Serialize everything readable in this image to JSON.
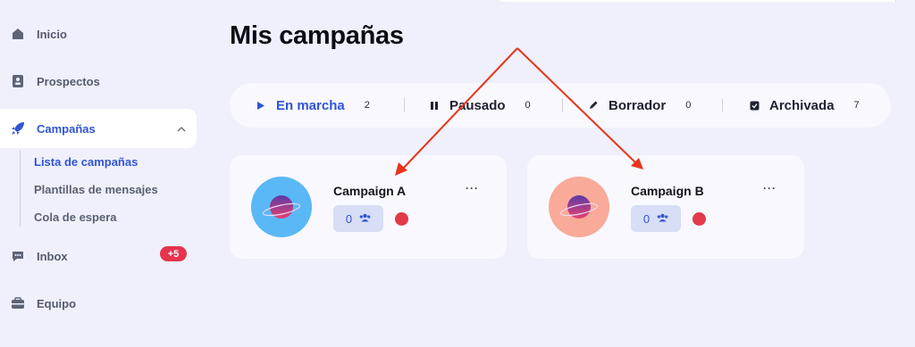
{
  "sidebar": {
    "items": [
      {
        "label": "Inicio",
        "icon": "home-icon"
      },
      {
        "label": "Prospectos",
        "icon": "contacts-icon"
      },
      {
        "label": "Campañas",
        "icon": "rocket-icon"
      },
      {
        "label": "Inbox",
        "icon": "chat-icon",
        "badge": "+5"
      },
      {
        "label": "Equipo",
        "icon": "team-icon"
      }
    ],
    "subitems": [
      {
        "label": "Lista de campañas"
      },
      {
        "label": "Plantillas de mensajes"
      },
      {
        "label": "Cola de espera"
      }
    ]
  },
  "main": {
    "title": "Mis campañas",
    "tabs": [
      {
        "label": "En marcha",
        "count": "2",
        "icon": "play-icon"
      },
      {
        "label": "Pausado",
        "count": "0",
        "icon": "pause-icon"
      },
      {
        "label": "Borrador",
        "count": "0",
        "icon": "pencil-icon"
      },
      {
        "label": "Archivada",
        "count": "7",
        "icon": "archive-icon"
      }
    ],
    "campaigns": [
      {
        "name": "Campaign A",
        "menu": "···",
        "prospects": "0",
        "avatar_color": "#5ab8f7"
      },
      {
        "name": "Campaign B",
        "menu": "···",
        "prospects": "0",
        "avatar_color": "#f9aa98"
      }
    ]
  },
  "colors": {
    "accent": "#2f54d6",
    "status_stopped": "#e13a48",
    "annotation": "#e8341c"
  }
}
